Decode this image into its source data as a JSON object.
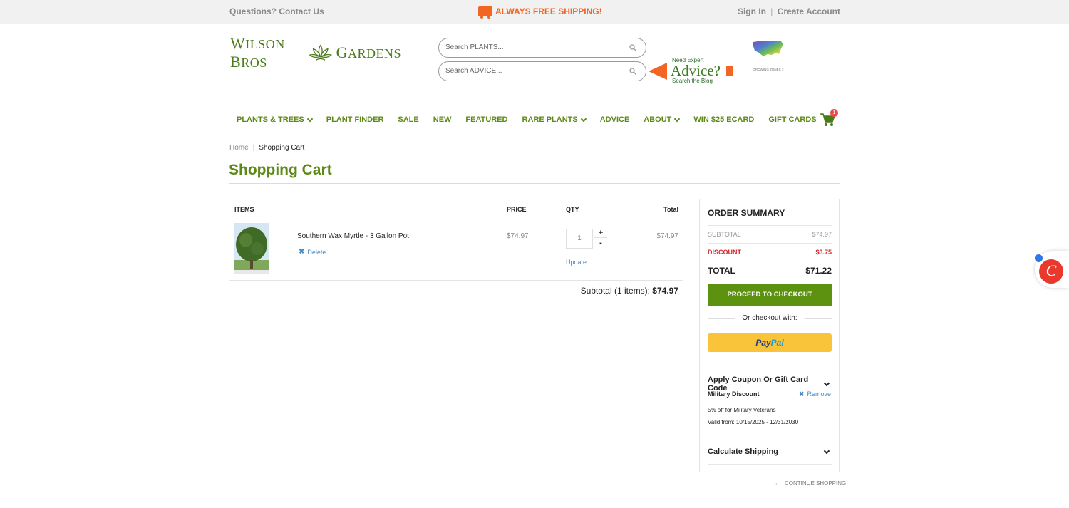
{
  "topbar": {
    "contact": "Questions? Contact Us",
    "shipping": "ALWAYS FREE SHIPPING!",
    "sign_in": "Sign In",
    "separator": "|",
    "create_account": "Create Account"
  },
  "logo": {
    "word1_big": "W",
    "word1": "ILSON ",
    "word2_big": "B",
    "word2": "ROS",
    "word3_big": "G",
    "word3": "ARDENS"
  },
  "search": {
    "plants_placeholder": "Search PLANTS...",
    "advice_placeholder": "Search ADVICE..."
  },
  "advice_ad": {
    "line1": "Need Expert",
    "line2": "Advice?",
    "line3": "Search the Blog"
  },
  "zones": {
    "label": "GROWING ZONES >"
  },
  "nav": {
    "items": [
      {
        "label": "PLANTS & TREES",
        "dropdown": true
      },
      {
        "label": "PLANT FINDER",
        "dropdown": false
      },
      {
        "label": "SALE",
        "dropdown": false
      },
      {
        "label": "NEW",
        "dropdown": false
      },
      {
        "label": "FEATURED",
        "dropdown": false
      },
      {
        "label": "RARE PLANTS",
        "dropdown": true
      },
      {
        "label": "ADVICE",
        "dropdown": false
      },
      {
        "label": "ABOUT",
        "dropdown": true
      },
      {
        "label": "WIN $25 ECARD",
        "dropdown": false
      },
      {
        "label": "GIFT CARDS",
        "dropdown": false
      }
    ],
    "cart_count": "1"
  },
  "breadcrumb": {
    "home": "Home",
    "separator": "|",
    "current": "Shopping Cart"
  },
  "page_title": "Shopping Cart",
  "cart": {
    "headers": {
      "items": "ITEMS",
      "price": "PRICE",
      "qty": "QTY",
      "total": "Total"
    },
    "rows": [
      {
        "name": "Southern Wax Myrtle - 3 Gallon Pot",
        "delete_label": "Delete",
        "price": "$74.97",
        "qty": "1",
        "plus": "+",
        "minus": "-",
        "update_label": "Update",
        "total": "$74.97"
      }
    ],
    "subtotal_label": "Subtotal (1 items):",
    "subtotal_value": "$74.97"
  },
  "summary": {
    "title": "ORDER SUMMARY",
    "subtotal_label": "SUBTOTAL",
    "subtotal_value": "$74.97",
    "discount_label": "DISCOUNT",
    "discount_value": "$3.75",
    "total_label": "TOTAL",
    "total_value": "$71.22",
    "checkout_button": "PROCEED TO CHECKOUT",
    "or_checkout": "Or checkout with:",
    "paypal_1": "Pay",
    "paypal_2": "Pal",
    "coupon_heading": "Apply Coupon Or Gift Card Code",
    "coupon_name": "Military Discount",
    "coupon_remove": "Remove",
    "coupon_desc": "5% off for Military Veterans",
    "coupon_valid": "Valid from: 10/15/2025 - 12/31/2030",
    "shipping_heading": "Calculate Shipping"
  },
  "continue_shopping": "CONTINUE SHOPPING",
  "colors": {
    "brand_green": "#5c8a15",
    "checkout_green": "#5c9210",
    "shipping_orange": "#f26522",
    "discount_red": "#d8262c",
    "link_blue": "#4a8ac2",
    "paypal_yellow": "#f9c33a"
  },
  "icons": [
    "truck-icon",
    "lotus-icon",
    "search-icon",
    "cart-icon",
    "caret-down-icon",
    "close-icon",
    "chevron-down-icon",
    "arrow-left-icon",
    "chat-widget-icon"
  ]
}
